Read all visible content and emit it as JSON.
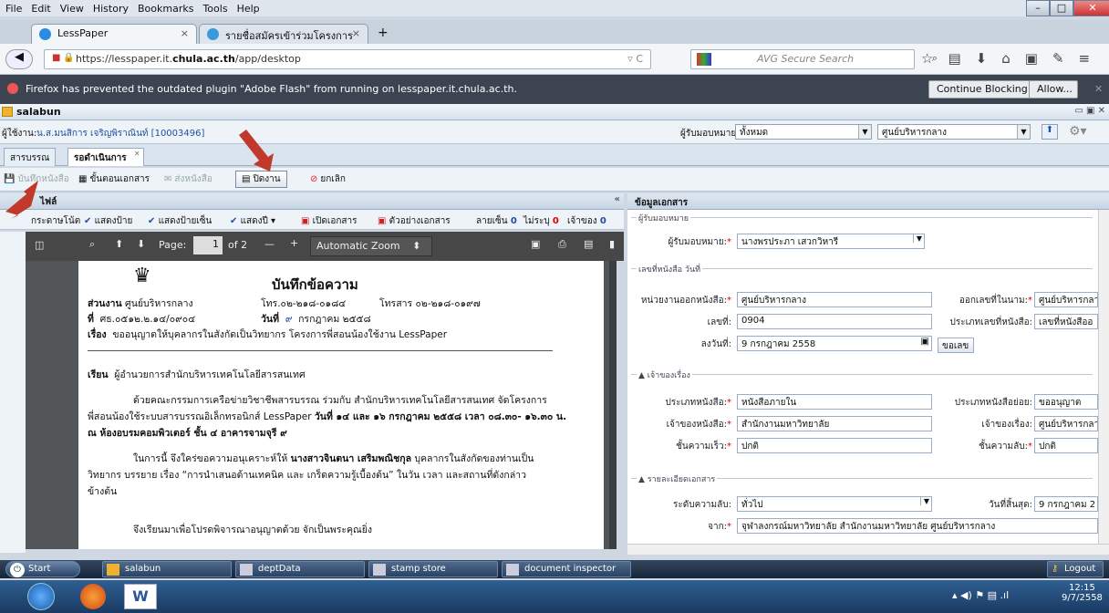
{
  "menu": {
    "items": [
      "File",
      "Edit",
      "View",
      "History",
      "Bookmarks",
      "Tools",
      "Help"
    ],
    "keys": [
      "F",
      "E",
      "V",
      "s",
      "B",
      "T",
      "H"
    ]
  },
  "browser_tabs": [
    {
      "label": "LessPaper",
      "close": "×"
    },
    {
      "label": "รายชื่อสมัครเข้าร่วมโครงการพี่...",
      "close": "×"
    }
  ],
  "new_tab": "+",
  "url": {
    "prefix": "https://lesspaper.it.",
    "domain": "chula.ac.th",
    "path": "/app/desktop"
  },
  "search": {
    "placeholder": "AVG Secure Search"
  },
  "flash": {
    "message": "Firefox has prevented the outdated plugin \"Adobe Flash\" from running on lesspaper.it.chula.ac.th.",
    "continue_label": "Continue Blocking",
    "allow_label": "Allow..."
  },
  "app": {
    "title": "salabun"
  },
  "userbar": {
    "user_label": "ผู้ใช้งาน:",
    "user_value": "น.ส.มนสิการ เจริญพิราณินท์ [10003496]",
    "assign_label": "ผู้รับมอบหมาย:",
    "assign_value": "ทั้งหมด",
    "unit_value": "ศูนย์บริหารกลาง"
  },
  "app_tabs": [
    {
      "label": "สารบรรณ"
    },
    {
      "label": "รอดำเนินการ"
    }
  ],
  "toolbar": {
    "save": "บันทึกหนังสือ",
    "steps": "ขั้นตอนเอกสาร",
    "send": "ส่งหนังสือ",
    "close": "ปิดงาน",
    "cancel": "ยกเลิก"
  },
  "left": {
    "header": "ไฟล์",
    "collapse": "«",
    "tools": [
      "กระดาษโน้ต",
      "แสดงป้าย",
      "แสดงป้ายเซ็น",
      "แสดงปี",
      "เปิดเอกสาร",
      "ตัวอย่างเอกสาร"
    ],
    "sign_label": "ลายเซ็น",
    "sign_count": "0",
    "bad_label": "ไม่ระบุ",
    "bad_count": "0",
    "owner_label": "เจ้าของ",
    "owner_count": "0"
  },
  "pdf": {
    "page_label": "Page:",
    "page": "1",
    "of": "of 2",
    "zoom": "Automatic Zoom",
    "minus": "—",
    "plus": "+"
  },
  "memo": {
    "title": "บันทึกข้อความ",
    "dept_label": "ส่วนงาน",
    "dept": "ศูนย์บริหารกลาง",
    "tel": "โทร.๐๒-๒๑๘-๐๑๘๔",
    "fax": "โทรสาร ๐๒-๒๑๘-๐๑๙๗",
    "no_label": "ที่",
    "no": "ศธ.๐๕๑๒.๒.๑๔/๐๙๐๔",
    "date_label": "วันที่",
    "date_day": "๙",
    "date_rest": "กรกฎาคม ๒๕๕๘",
    "subject_label": "เรื่อง",
    "subject": "ขออนุญาตให้บุคลากรในสังกัดเป็นวิทยากร โครงการพี่สอนน้องใช้งาน LessPaper",
    "to_label": "เรียน",
    "to": "ผู้อำนวยการสำนักบริหารเทคโนโลยีสารสนเทศ",
    "p1a": "ด้วยคณะกรรมการเครือข่ายวิชาชีพสารบรรณ ร่วมกับ สำนักบริหารเทคโนโลยีสารสนเทศ จัดโครงการ",
    "p1b": "พี่สอนน้องใช้ระบบสารบรรณอิเล็กทรอนิกส์ LessPaper",
    "p1bold": "วันที่ ๑๔ และ ๑๖ กรกฎาคม ๒๕๕๘ เวลา ๐๘.๓๐- ๑๖.๓๐ น.",
    "p1c": "ณ ห้องอบรมคอมพิวเตอร์ ชั้น ๔ อาคารจามจุรี ๙",
    "p2a": "ในการนี้ จึงใคร่ขอความอนุเคราะห์ให้",
    "p2name": "นางสาวจินตนา เสริมพณิชกุล",
    "p2b": "บุคลากรในสังกัดของท่านเป็น",
    "p2c": "วิทยากร บรรยาย เรื่อง “การนำเสนอด้านเทคนิค และ เกร็ดความรู้เบื้องต้น” ในวัน เวลา และสถานที่ดังกล่าว",
    "p2d": "ข้างต้น",
    "p3": "จึงเรียนมาเพื่อโปรดพิจารณาอนุญาตด้วย จักเป็นพระคุณยิ่ง"
  },
  "right": {
    "header": "ข้อมูลเอกสาร",
    "assign_section": "ผู้รับมอบหมาย",
    "assign_label": "ผู้รับมอบหมาย:",
    "assign_value": "นางพรประภา เสวกวิหารี",
    "doc_section": "เลขที่หนังสือ วันที่",
    "issuer_label": "หน่วยงานออกหนังสือ:",
    "issuer_value": "ศูนย์บริหารกลาง",
    "issue_in_label": "ออกเลขที่ในนาม:",
    "issue_in_value": "ศูนย์บริหารกลาง",
    "number_label": "เลขที่:",
    "number_value": "0904",
    "numtype_label": "ประเภทเลขที่หนังสือ:",
    "numtype_value": "เลขที่หนังสืออ",
    "date_label": "ลงวันที่:",
    "date_value": "9 กรกฎาคม 2558",
    "getnum_label": "ขอเลข",
    "owner_section": "เจ้าของเรื่อง",
    "type_label": "ประเภทหนังสือ:",
    "type_value": "หนังสือภายใน",
    "subtype_label": "ประเภทหนังสือย่อย:",
    "subtype_value": "ขออนุญาต",
    "owner_label": "เจ้าของหนังสือ:",
    "owner_value": "สำนักงานมหาวิทยาลัย",
    "owner2_label": "เจ้าของเรื่อง:",
    "owner2_value": "ศูนย์บริหารกลาง",
    "urgency_label": "ชั้นความเร็ว:",
    "urgency_value": "ปกติ",
    "secret_label": "ชั้นความลับ:",
    "secret_value": "ปกติ",
    "detail_section": "รายละเอียดเอกสาร",
    "level_label": "ระดับความลับ:",
    "level_value": "ทั่วไป",
    "end_label": "วันที่สิ้นสุด:",
    "end_value": "9 กรกฎาคม 2",
    "from_label": "จาก:",
    "from_value": "จุฬาลงกรณ์มหาวิทยาลัย สำนักงานมหาวิทยาลัย ศูนย์บริหารกลาง"
  },
  "taskbar": {
    "start": "Start",
    "items": [
      "salabun",
      "deptData",
      "stamp store",
      "document inspector"
    ],
    "logout": "Logout"
  },
  "clock": {
    "time": "12:15",
    "date": "9/7/2558"
  },
  "colors": {
    "accent": "#1e4fa0",
    "required": "#dd0000",
    "arrow": "#c0392b"
  }
}
